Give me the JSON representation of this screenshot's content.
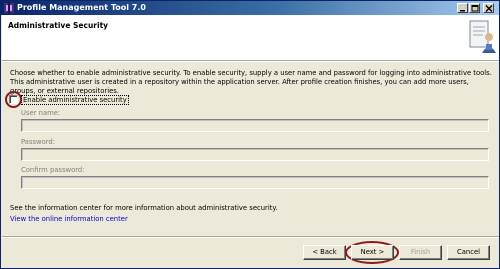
{
  "window": {
    "title": "Profile Management Tool 7.0"
  },
  "header": {
    "title": "Administrative Security"
  },
  "description": "Choose whether to enable administrative security. To enable security, supply a user name and password for logging into administrative tools. This administrative user is created in a repository within the application server. After profile creation finishes, you can add more users, groups, or external repositories.",
  "security": {
    "enable_label": "Enable administrative security",
    "enabled": false,
    "user_name_label": "User name:",
    "user_name_value": "",
    "password_label": "Password:",
    "password_value": "",
    "confirm_password_label": "Confirm password:",
    "confirm_password_value": ""
  },
  "info": {
    "text": "See the information center for more information about administrative security.",
    "link": "View the online information center"
  },
  "buttons": {
    "back": "< Back",
    "next": "Next >",
    "finish": "Finish",
    "cancel": "Cancel"
  },
  "colors": {
    "title_bar": "#0a246a",
    "highlight": "#8b1a1a",
    "link": "#0000cc"
  }
}
